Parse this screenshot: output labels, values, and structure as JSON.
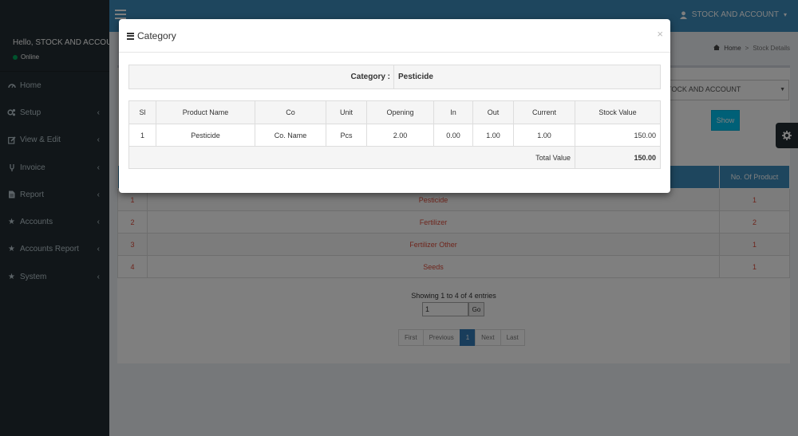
{
  "sidebar": {
    "greeting": "Hello, STOCK AND ACCOUNT",
    "status": "Online",
    "items": [
      {
        "label": "Home",
        "icon": "dashboard-icon",
        "has_children": false
      },
      {
        "label": "Setup",
        "icon": "cogs-icon",
        "has_children": true
      },
      {
        "label": "View & Edit",
        "icon": "edit-icon",
        "has_children": true
      },
      {
        "label": "Invoice",
        "icon": "invoice-icon",
        "has_children": true
      },
      {
        "label": "Report",
        "icon": "file-icon",
        "has_children": true
      },
      {
        "label": "Accounts",
        "icon": "star-icon",
        "has_children": true
      },
      {
        "label": "Accounts Report",
        "icon": "star-icon",
        "has_children": true
      },
      {
        "label": "System",
        "icon": "star-icon",
        "has_children": true
      }
    ]
  },
  "header": {
    "user_label": "STOCK AND ACCOUNT"
  },
  "content": {
    "breadcrumb": {
      "home": "Home",
      "separator": ">",
      "current": "Stock Details"
    },
    "select_value": "STOCK AND ACCOUNT",
    "show_label": "Show",
    "table": {
      "columns": [
        "",
        "",
        "No. Of Product"
      ],
      "rows": [
        {
          "sl": "1",
          "name": "Pesticide",
          "count": "1"
        },
        {
          "sl": "2",
          "name": "Fertilizer",
          "count": "2"
        },
        {
          "sl": "3",
          "name": "Fertilizer Other",
          "count": "1"
        },
        {
          "sl": "4",
          "name": "Seeds",
          "count": "1"
        }
      ]
    },
    "info_text": "Showing 1 to 4 of 4 entries",
    "goto_value": "1",
    "go_label": "Go",
    "pager": [
      "First",
      "Previous",
      "1",
      "Next",
      "Last"
    ],
    "pager_active": "1"
  },
  "modal": {
    "title": "Category",
    "close_symbol": "×",
    "category_label": "Category :",
    "category_value": "Pesticide",
    "columns": [
      "Sl",
      "Product Name",
      "Co",
      "Unit",
      "Opening",
      "In",
      "Out",
      "Current",
      "Stock Value"
    ],
    "rows": [
      {
        "sl": "1",
        "product": "Pesticide",
        "co": "Co. Name",
        "unit": "Pcs",
        "opening": "2.00",
        "in": "0.00",
        "out": "1.00",
        "current": "1.00",
        "value": "150.00"
      }
    ],
    "total_label": "Total Value",
    "total_value": "150.00"
  },
  "colors": {
    "header": "#3c8dbc",
    "sidebar": "#222d32",
    "link_red": "#dd4b39",
    "show_button": "#00c0ef"
  }
}
